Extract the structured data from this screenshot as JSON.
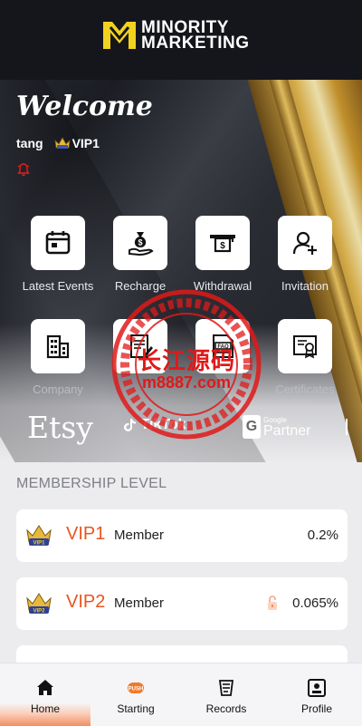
{
  "brand": {
    "line1": "MINORITY",
    "line2": "MARKETING",
    "accent_color": "#f2d21c"
  },
  "welcome": "Welcome",
  "user": {
    "name": "tang",
    "level": "VIP1"
  },
  "quick_actions": [
    {
      "label": "Latest Events",
      "icon": "calendar-icon"
    },
    {
      "label": "Recharge",
      "icon": "money-bag-icon"
    },
    {
      "label": "Withdrawal",
      "icon": "cash-withdraw-icon"
    },
    {
      "label": "Invitation",
      "icon": "add-user-icon"
    },
    {
      "label": "Company",
      "icon": "building-icon"
    },
    {
      "label": "",
      "icon": "document-edit-icon"
    },
    {
      "label": "",
      "icon": "document-faq-icon"
    },
    {
      "label": "Certificates",
      "icon": "certificate-icon"
    }
  ],
  "partners": {
    "etsy": "Etsy",
    "tiktok": "TikTok",
    "google_small": "Google",
    "google_big": "Partner"
  },
  "watermark": {
    "line1": "长江源码",
    "line2": "m8887.com"
  },
  "membership": {
    "title": "MEMBERSHIP LEVEL",
    "levels": [
      {
        "vip": "VIP1",
        "tag": "Member",
        "rate": "0.2%",
        "locked": false
      },
      {
        "vip": "VIP2",
        "tag": "Member",
        "rate": "0.065%",
        "locked": true
      }
    ]
  },
  "nav": {
    "items": [
      {
        "label": "Home",
        "icon": "home-icon",
        "active": true
      },
      {
        "label": "Starting",
        "icon": "starting-icon",
        "active": false
      },
      {
        "label": "Records",
        "icon": "records-icon",
        "active": false
      },
      {
        "label": "Profile",
        "icon": "profile-icon",
        "active": false
      }
    ],
    "active_color": "#f08a5c"
  }
}
